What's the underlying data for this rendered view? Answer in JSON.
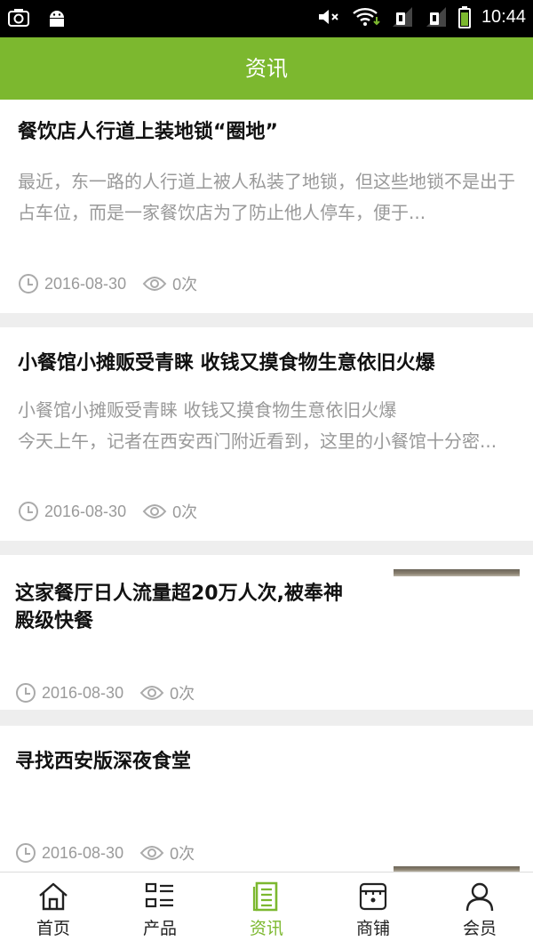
{
  "status_bar": {
    "time": "10:44"
  },
  "header": {
    "title": "资讯"
  },
  "articles": [
    {
      "title": "餐饮店人行道上装地锁“圈地”",
      "summary": "最近，东一路的人行道上被人私装了地锁，但这些地锁不是出于占车位，而是一家餐饮店为了防止他人停车，便于...",
      "date": "2016-08-30",
      "views": "0次"
    },
    {
      "title": "小餐馆小摊贩受青睐 收钱又摸食物生意依旧火爆",
      "summary": "小餐馆小摊贩受青睐 收钱又摸食物生意依旧火爆\n今天上午，记者在西安西门附近看到，这里的小餐馆十分密...",
      "date": "2016-08-30",
      "views": "0次"
    },
    {
      "title": "这家餐厅日人流量超20万人次,被奉神殿级快餐",
      "date": "2016-08-30",
      "views": "0次"
    },
    {
      "title": "寻找西安版深夜食堂",
      "date": "2016-08-30",
      "views": "0次"
    }
  ],
  "bottom_nav": {
    "items": [
      {
        "label": "首页",
        "icon": "home-icon"
      },
      {
        "label": "产品",
        "icon": "product-list-icon"
      },
      {
        "label": "资讯",
        "icon": "news-icon",
        "active": true
      },
      {
        "label": "商铺",
        "icon": "shop-icon"
      },
      {
        "label": "会员",
        "icon": "member-icon"
      }
    ]
  },
  "colors": {
    "accent": "#7cb82f",
    "muted_text": "#999999",
    "background": "#eeeeee"
  }
}
